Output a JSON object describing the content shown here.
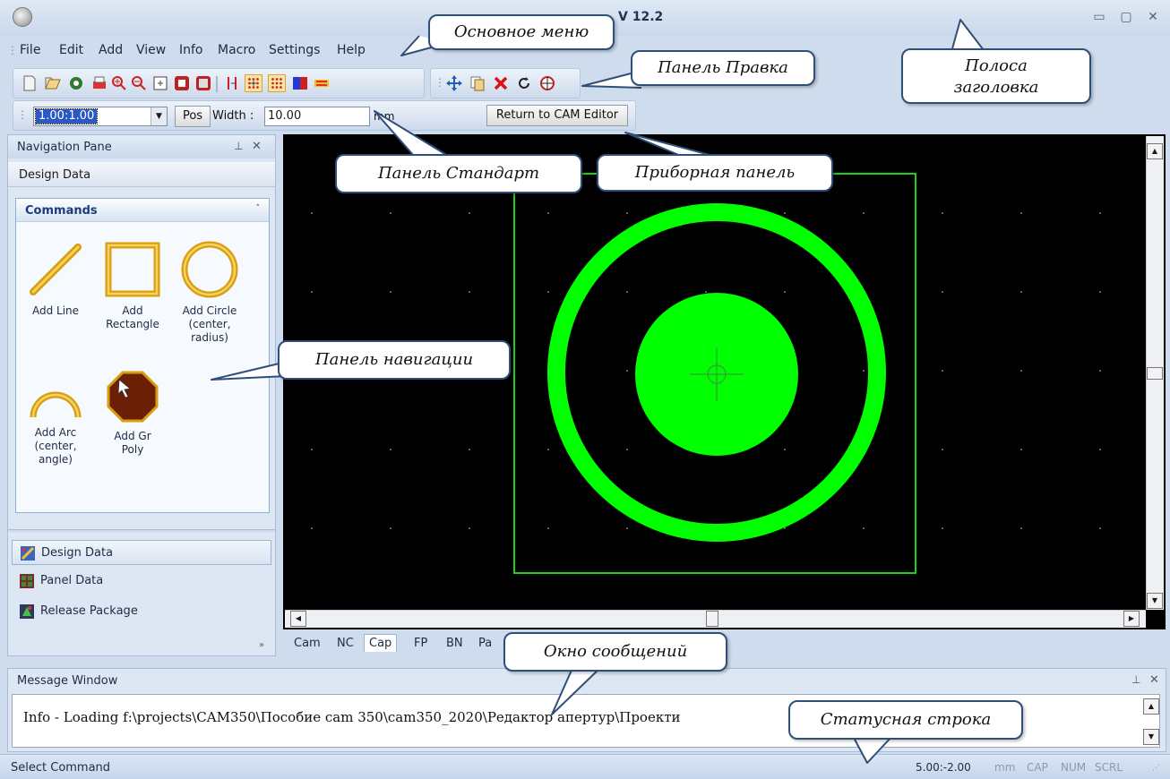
{
  "window": {
    "title": "V 12.2",
    "minimize": "▭",
    "maximize": "▢",
    "close": "✕"
  },
  "menu": [
    "File",
    "Edit",
    "Add",
    "View",
    "Info",
    "Macro",
    "Settings",
    "Help"
  ],
  "dashboard": {
    "zoom_value": "1.00:1.00",
    "pos_label": "Pos",
    "width_label": "Width :",
    "width_value": "10.00",
    "unit": "mm",
    "return_button": "Return to CAM Editor"
  },
  "navigation_pane": {
    "title": "Navigation Pane",
    "pin": "⊥",
    "close": "✕",
    "section": "Design Data",
    "commands_title": "Commands",
    "commands": [
      {
        "label_lines": [
          "Add Line"
        ],
        "icon": "line-icon"
      },
      {
        "label_lines": [
          "Add",
          "Rectangle"
        ],
        "icon": "rectangle-icon"
      },
      {
        "label_lines": [
          "Add Circle",
          "(center,",
          "radius)"
        ],
        "icon": "circle-icon"
      },
      {
        "label_lines": [
          "Add Arc",
          "(center,",
          "angle)"
        ],
        "icon": "arc-icon"
      },
      {
        "label_lines": [
          "Add Gr",
          "Poly"
        ],
        "icon": "polygon-icon"
      }
    ],
    "buttons": [
      {
        "label": "Design Data",
        "selected": true
      },
      {
        "label": "Panel Data",
        "selected": false
      },
      {
        "label": "Release Package",
        "selected": false
      }
    ],
    "more": "»"
  },
  "tabs": [
    {
      "label": "Cam",
      "selected": false
    },
    {
      "label": "NC",
      "selected": false
    },
    {
      "label": "Cap",
      "selected": true
    },
    {
      "label": "FP",
      "selected": false
    },
    {
      "label": "BN",
      "selected": false
    },
    {
      "label": "Pa",
      "selected": false
    }
  ],
  "message_window": {
    "title": "Message Window",
    "pin": "⊥",
    "close": "✕",
    "text": "Info - Loading f:\\projects\\CAM350\\Пособие cam 350\\cam350_2020\\Редактор апертур\\Проекти"
  },
  "status": {
    "left": "Select Command",
    "coords": "5.00:-2.00",
    "unit": "mm",
    "cap": "CAP",
    "num": "NUM",
    "scrl": "SCRL"
  },
  "annotations": {
    "main_menu": "Основное меню",
    "edit_panel": "Панель Правка",
    "title_bar_line1": "Полоса",
    "title_bar_line2": "заголовка",
    "standard_panel": "Панель Стандарт",
    "dashboard_panel": "Приборная панель",
    "navigation_panel": "Панель навигации",
    "message_window": "Окно сообщений",
    "status_bar": "Статусная строка"
  },
  "colors": {
    "canvas_bg": "#000000",
    "pad_green": "#00ff00",
    "outline_green": "#19d119"
  }
}
